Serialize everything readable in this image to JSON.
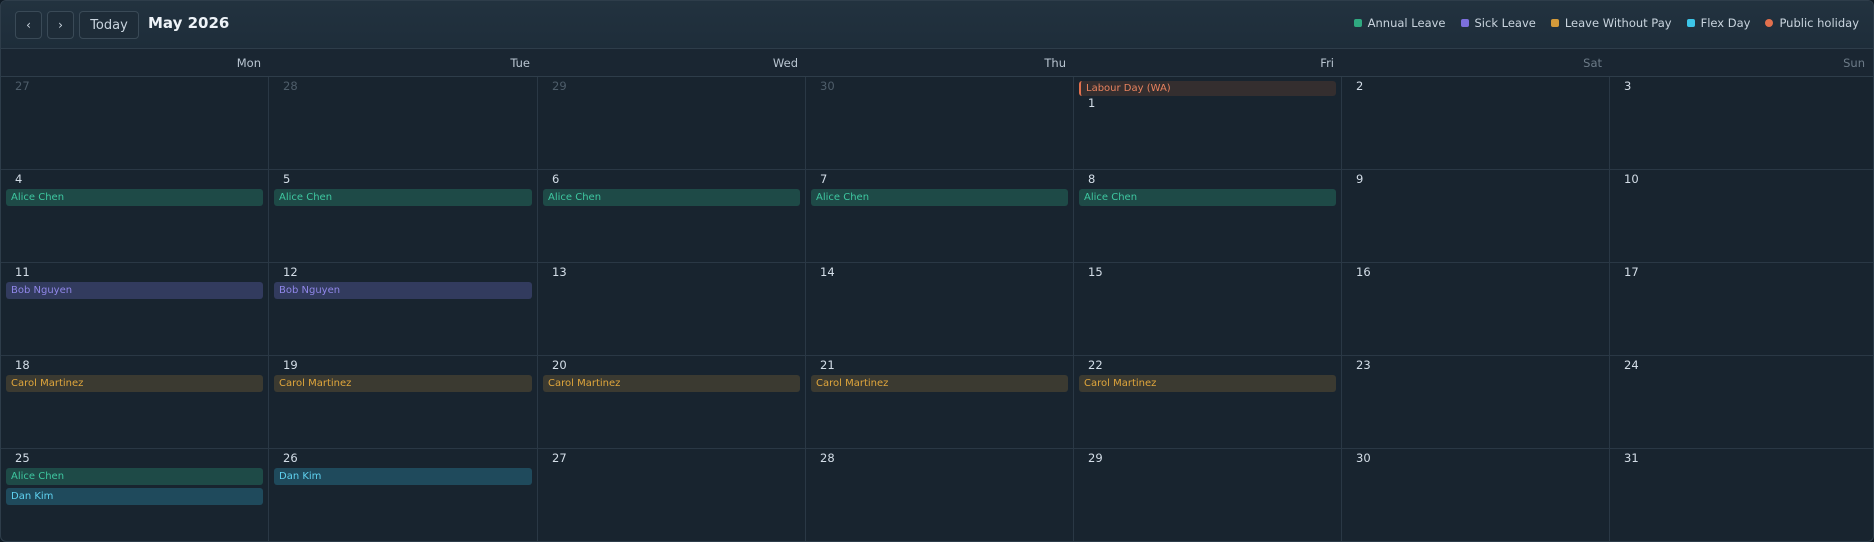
{
  "toolbar": {
    "prev_label": "‹",
    "next_label": "›",
    "today_label": "Today",
    "title": "May 2026"
  },
  "legend": [
    {
      "label": "Annual Leave",
      "color": "#2fa980",
      "shape": "square"
    },
    {
      "label": "Sick Leave",
      "color": "#7c6fdd",
      "shape": "square"
    },
    {
      "label": "Leave Without Pay",
      "color": "#d49a3a",
      "shape": "square"
    },
    {
      "label": "Flex Day",
      "color": "#3cc5e8",
      "shape": "square"
    },
    {
      "label": "Public holiday",
      "color": "#e2704d",
      "shape": "circle"
    }
  ],
  "weekdays": [
    {
      "label": "Mon",
      "weekend": false
    },
    {
      "label": "Tue",
      "weekend": false
    },
    {
      "label": "Wed",
      "weekend": false
    },
    {
      "label": "Thu",
      "weekend": false
    },
    {
      "label": "Fri",
      "weekend": false
    },
    {
      "label": "Sat",
      "weekend": true
    },
    {
      "label": "Sun",
      "weekend": true
    }
  ],
  "weeks": [
    [
      {
        "day": "27",
        "outside": true,
        "events": []
      },
      {
        "day": "28",
        "outside": true,
        "events": []
      },
      {
        "day": "29",
        "outside": true,
        "events": []
      },
      {
        "day": "30",
        "outside": true,
        "events": []
      },
      {
        "day": "1",
        "outside": false,
        "holiday": "Labour Day (WA)",
        "events": []
      },
      {
        "day": "2",
        "outside": false,
        "events": []
      },
      {
        "day": "3",
        "outside": false,
        "events": []
      }
    ],
    [
      {
        "day": "4",
        "outside": false,
        "events": [
          {
            "name": "Alice Chen",
            "type": "annual"
          }
        ]
      },
      {
        "day": "5",
        "outside": false,
        "events": [
          {
            "name": "Alice Chen",
            "type": "annual"
          }
        ]
      },
      {
        "day": "6",
        "outside": false,
        "events": [
          {
            "name": "Alice Chen",
            "type": "annual"
          }
        ]
      },
      {
        "day": "7",
        "outside": false,
        "events": [
          {
            "name": "Alice Chen",
            "type": "annual"
          }
        ]
      },
      {
        "day": "8",
        "outside": false,
        "events": [
          {
            "name": "Alice Chen",
            "type": "annual"
          }
        ]
      },
      {
        "day": "9",
        "outside": false,
        "events": []
      },
      {
        "day": "10",
        "outside": false,
        "events": []
      }
    ],
    [
      {
        "day": "11",
        "outside": false,
        "events": [
          {
            "name": "Bob Nguyen",
            "type": "sick"
          }
        ]
      },
      {
        "day": "12",
        "outside": false,
        "events": [
          {
            "name": "Bob Nguyen",
            "type": "sick"
          }
        ]
      },
      {
        "day": "13",
        "outside": false,
        "events": []
      },
      {
        "day": "14",
        "outside": false,
        "events": []
      },
      {
        "day": "15",
        "outside": false,
        "events": []
      },
      {
        "day": "16",
        "outside": false,
        "events": []
      },
      {
        "day": "17",
        "outside": false,
        "events": []
      }
    ],
    [
      {
        "day": "18",
        "outside": false,
        "events": [
          {
            "name": "Carol Martinez",
            "type": "lwop"
          }
        ]
      },
      {
        "day": "19",
        "outside": false,
        "events": [
          {
            "name": "Carol Martinez",
            "type": "lwop"
          }
        ]
      },
      {
        "day": "20",
        "outside": false,
        "events": [
          {
            "name": "Carol Martinez",
            "type": "lwop"
          }
        ]
      },
      {
        "day": "21",
        "outside": false,
        "events": [
          {
            "name": "Carol Martinez",
            "type": "lwop"
          }
        ]
      },
      {
        "day": "22",
        "outside": false,
        "events": [
          {
            "name": "Carol Martinez",
            "type": "lwop"
          }
        ]
      },
      {
        "day": "23",
        "outside": false,
        "events": []
      },
      {
        "day": "24",
        "outside": false,
        "events": []
      }
    ],
    [
      {
        "day": "25",
        "outside": false,
        "events": [
          {
            "name": "Alice Chen",
            "type": "annual"
          },
          {
            "name": "Dan Kim",
            "type": "flex"
          }
        ]
      },
      {
        "day": "26",
        "outside": false,
        "events": [
          {
            "name": "Dan Kim",
            "type": "flex"
          }
        ]
      },
      {
        "day": "27",
        "outside": false,
        "events": []
      },
      {
        "day": "28",
        "outside": false,
        "events": []
      },
      {
        "day": "29",
        "outside": false,
        "events": []
      },
      {
        "day": "30",
        "outside": false,
        "events": []
      },
      {
        "day": "31",
        "outside": false,
        "events": []
      }
    ]
  ]
}
